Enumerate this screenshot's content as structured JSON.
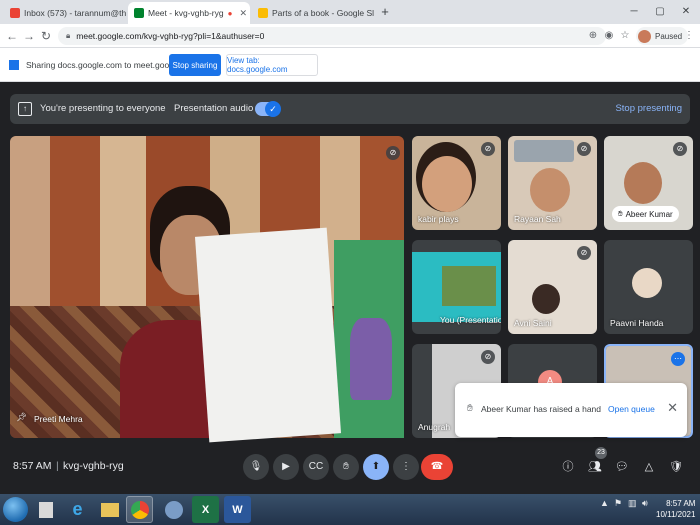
{
  "browser": {
    "tabs": [
      {
        "label": "Inbox (573) - tarannum@theindi",
        "favicon_color": "#ea4335",
        "active": false
      },
      {
        "label": "Meet - kvg-vghb-ryg",
        "favicon_color": "#00832d",
        "active": true
      },
      {
        "label": "Parts of a book - Google Sli",
        "favicon_color": "#fbbc04",
        "active": false
      }
    ],
    "new_tab_label": "+",
    "url": "meet.google.com/kvg-vghb-ryg?pli=1&authuser=0",
    "profile_label": "Paused"
  },
  "share_bar": {
    "text": "Sharing docs.google.com to meet.google.com",
    "stop_label": "Stop sharing",
    "view_label": "View tab: docs.google.com"
  },
  "presentation_bar": {
    "presenting_text": "You're presenting to everyone",
    "audio_label": "Presentation audio",
    "audio_enabled": true,
    "stop_label": "Stop presenting"
  },
  "main_tile": {
    "name": "Preeti Mehra"
  },
  "tiles": [
    {
      "name": "kabir plays",
      "muted": true
    },
    {
      "name": "Rayaan Sah",
      "muted": true
    },
    {
      "name": "Abeer Kumar",
      "muted": true,
      "hand_raised": true
    },
    {
      "name": "You (Presentation)",
      "muted": false
    },
    {
      "name": "Avni Saini",
      "muted": true
    },
    {
      "name": "Paavni Handa",
      "muted": false
    },
    {
      "name": "Anugrah",
      "muted": true
    },
    {
      "name": "A",
      "muted": false
    },
    {
      "name": "",
      "muted": false
    }
  ],
  "toast": {
    "text": "Abeer Kumar has raised a hand",
    "action_label": "Open queue"
  },
  "bottom": {
    "time": "8:57 AM",
    "separator": "|",
    "meeting_code": "kvg-vghb-ryg",
    "participants_count": "23"
  },
  "taskbar": {
    "time": "8:57 AM",
    "date": "10/11/2021"
  },
  "colors": {
    "meet_bg": "#202124",
    "accent_blue": "#1a73e8",
    "hangup_red": "#ea4335",
    "present_active": "#8ab4f8"
  }
}
